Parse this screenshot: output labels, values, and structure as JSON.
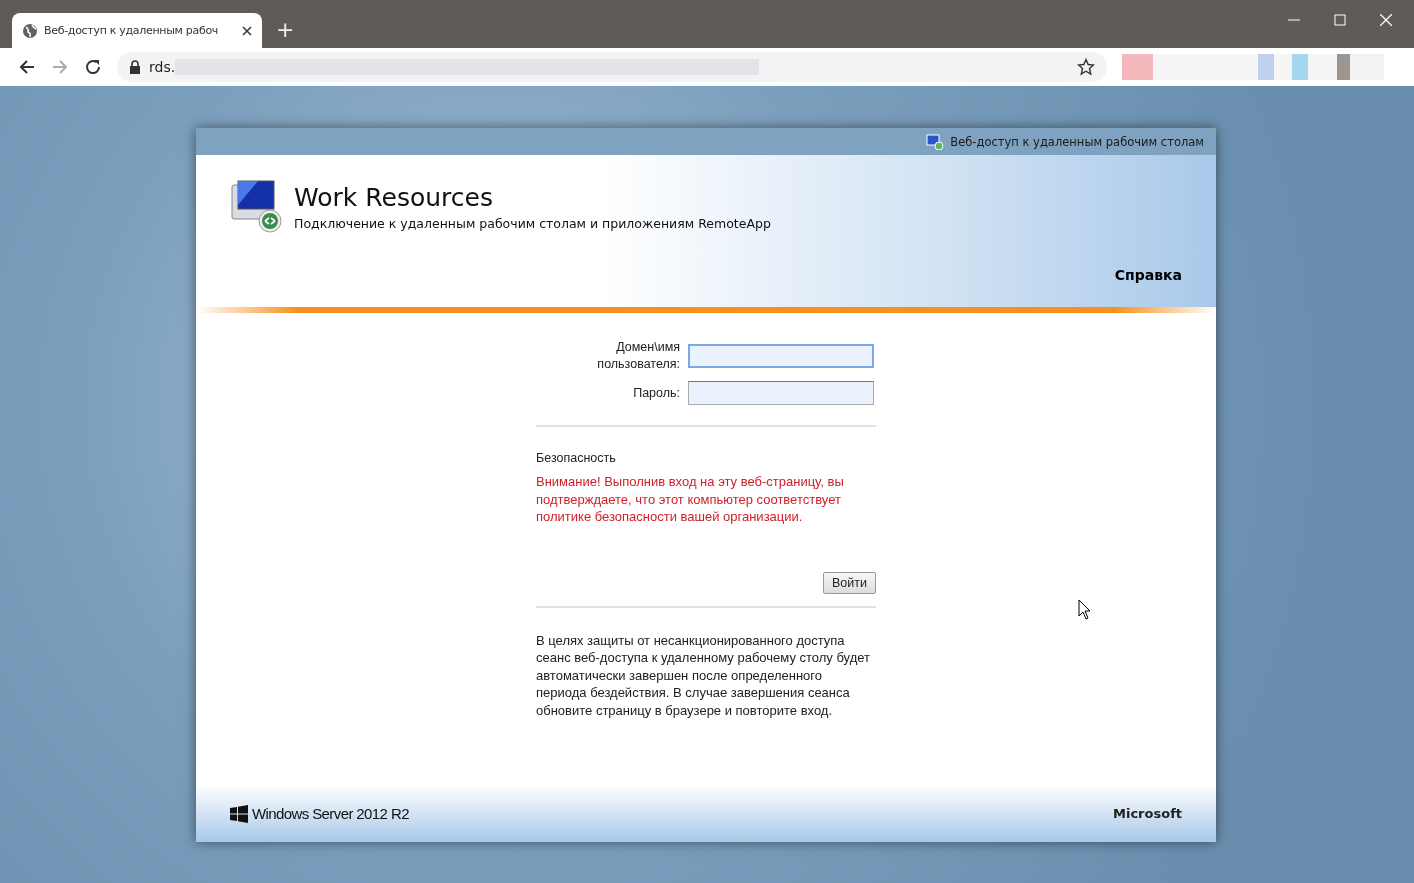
{
  "browser": {
    "tab_title": "Веб-доступ к удаленным рабоч",
    "new_tab": "+",
    "address": "rds."
  },
  "page": {
    "top_bar_title": "Веб-доступ к удаленным рабочим столам",
    "title": "Work Resources",
    "subtitle": "Подключение к удаленным рабочим столам и приложениям RemoteApp",
    "help_link": "Справка",
    "fields": [
      {
        "label": "Домен\\имя пользователя:",
        "focused": true
      },
      {
        "label": "Пароль:",
        "focused": false
      }
    ],
    "security_heading": "Безопасность",
    "security_warning": "Внимание! Выполнив вход на эту веб-страницу, вы подтверждаете, что этот компьютер соответствует политике безопасности вашей организации.",
    "sign_in_button": "Войти",
    "timeout_note": "В целях защиты от несанкционированного доступа сеанс веб-доступа к удаленному рабочему столу будет автоматически завершен после определенного периода бездействия. В случае завершения сеанса обновите страницу в браузере и повторите вход.",
    "footer_product": "Windows Server 2012 R2",
    "footer_brand": "Microsoft"
  }
}
